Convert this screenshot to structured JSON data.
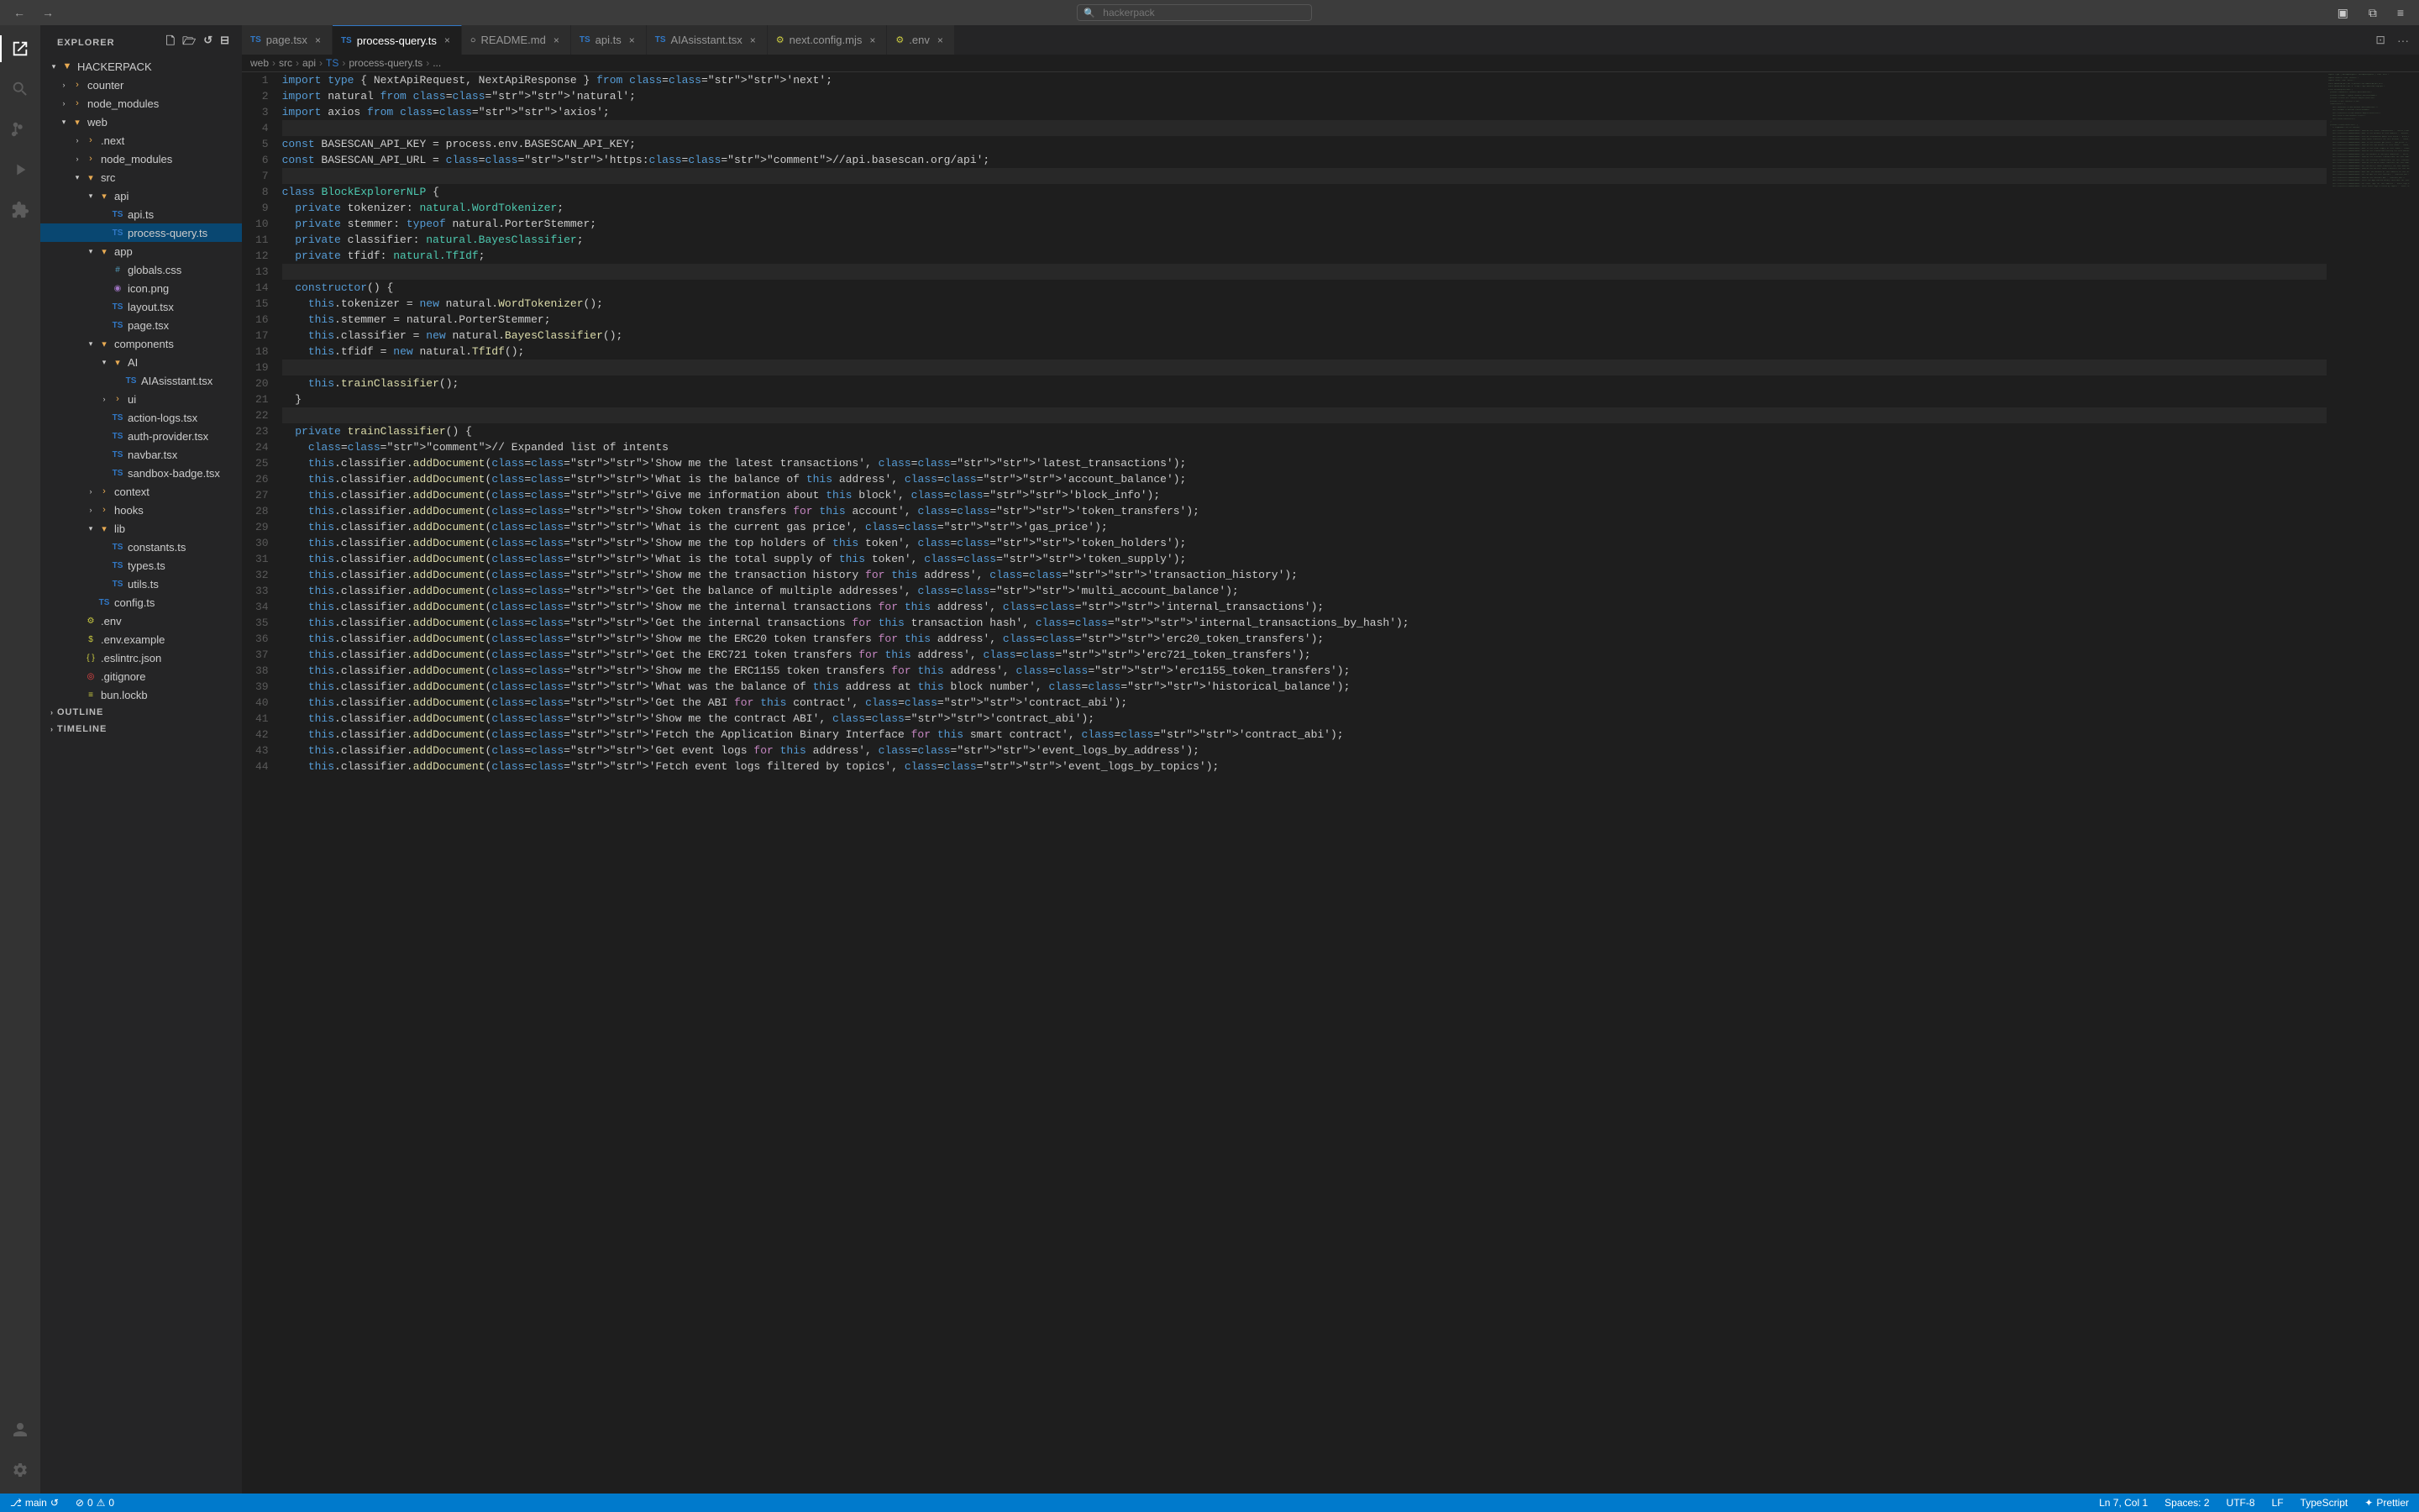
{
  "titleBar": {
    "searchPlaceholder": "hackerpack",
    "navBack": "←",
    "navForward": "→"
  },
  "activityBar": {
    "icons": [
      {
        "name": "explorer-icon",
        "symbol": "⎘",
        "active": true
      },
      {
        "name": "search-icon",
        "symbol": "🔍",
        "active": false
      },
      {
        "name": "source-control-icon",
        "symbol": "⎇",
        "active": false
      },
      {
        "name": "run-icon",
        "symbol": "▷",
        "active": false
      },
      {
        "name": "extensions-icon",
        "symbol": "⊞",
        "active": false
      }
    ],
    "bottomIcons": [
      {
        "name": "accounts-icon",
        "symbol": "👤"
      },
      {
        "name": "settings-icon",
        "symbol": "⚙"
      }
    ]
  },
  "sidebar": {
    "title": "EXPLORER",
    "rootFolder": "HACKERPACK",
    "tree": [
      {
        "id": "counter",
        "label": "counter",
        "type": "folder",
        "indent": 1,
        "open": false
      },
      {
        "id": "node_modules_root",
        "label": "node_modules",
        "type": "folder",
        "indent": 1,
        "open": false
      },
      {
        "id": "web",
        "label": "web",
        "type": "folder",
        "indent": 1,
        "open": true
      },
      {
        "id": "next",
        "label": ".next",
        "type": "folder",
        "indent": 2,
        "open": false
      },
      {
        "id": "node_modules_web",
        "label": "node_modules",
        "type": "folder",
        "indent": 2,
        "open": false
      },
      {
        "id": "src",
        "label": "src",
        "type": "folder",
        "indent": 2,
        "open": true
      },
      {
        "id": "api",
        "label": "api",
        "type": "folder",
        "indent": 3,
        "open": true
      },
      {
        "id": "api_ts",
        "label": "api.ts",
        "type": "ts",
        "indent": 4
      },
      {
        "id": "process_query",
        "label": "process-query.ts",
        "type": "ts",
        "indent": 4,
        "selected": true
      },
      {
        "id": "app",
        "label": "app",
        "type": "folder",
        "indent": 3,
        "open": true
      },
      {
        "id": "globals_css",
        "label": "globals.css",
        "type": "css",
        "indent": 4
      },
      {
        "id": "icon_png",
        "label": "icon.png",
        "type": "png",
        "indent": 4
      },
      {
        "id": "layout_tsx",
        "label": "layout.tsx",
        "type": "tsx",
        "indent": 4
      },
      {
        "id": "page_tsx",
        "label": "page.tsx",
        "type": "tsx",
        "indent": 4
      },
      {
        "id": "components",
        "label": "components",
        "type": "folder",
        "indent": 3,
        "open": true
      },
      {
        "id": "AI",
        "label": "AI",
        "type": "folder",
        "indent": 4,
        "open": true
      },
      {
        "id": "AIAsisstant_tsx",
        "label": "AIAsisstant.tsx",
        "type": "tsx",
        "indent": 5
      },
      {
        "id": "ui",
        "label": "ui",
        "type": "folder",
        "indent": 4,
        "open": false
      },
      {
        "id": "action_logs",
        "label": "action-logs.tsx",
        "type": "tsx",
        "indent": 4
      },
      {
        "id": "auth_provider",
        "label": "auth-provider.tsx",
        "type": "tsx",
        "indent": 4
      },
      {
        "id": "navbar_tsx",
        "label": "navbar.tsx",
        "type": "tsx",
        "indent": 4
      },
      {
        "id": "sandbox_badge",
        "label": "sandbox-badge.tsx",
        "type": "tsx",
        "indent": 4
      },
      {
        "id": "context",
        "label": "context",
        "type": "folder",
        "indent": 3,
        "open": false
      },
      {
        "id": "hooks",
        "label": "hooks",
        "type": "folder",
        "indent": 3,
        "open": false
      },
      {
        "id": "lib",
        "label": "lib",
        "type": "folder",
        "indent": 3,
        "open": true
      },
      {
        "id": "constants_ts",
        "label": "constants.ts",
        "type": "ts",
        "indent": 4
      },
      {
        "id": "types_ts",
        "label": "types.ts",
        "type": "ts",
        "indent": 4
      },
      {
        "id": "utils_ts",
        "label": "utils.ts",
        "type": "ts",
        "indent": 4
      },
      {
        "id": "config_ts",
        "label": "config.ts",
        "type": "ts",
        "indent": 3
      },
      {
        "id": "env",
        "label": ".env",
        "type": "env",
        "indent": 2
      },
      {
        "id": "env_example",
        "label": ".env.example",
        "type": "env",
        "indent": 2
      },
      {
        "id": "eslintrc",
        "label": ".eslintrc.json",
        "type": "json",
        "indent": 2
      },
      {
        "id": "gitignore",
        "label": ".gitignore",
        "type": "git",
        "indent": 2
      },
      {
        "id": "bun_lock",
        "label": "bun.lockb",
        "type": "lock",
        "indent": 2
      }
    ],
    "outlineLabel": "OUTLINE",
    "timelineLabel": "TIMELINE"
  },
  "tabs": [
    {
      "id": "page_tsx",
      "label": "page.tsx",
      "type": "tsx",
      "active": false,
      "dirty": false
    },
    {
      "id": "process_query",
      "label": "process-query.ts",
      "type": "ts",
      "active": true,
      "dirty": false
    },
    {
      "id": "readme",
      "label": "README.md",
      "type": "md",
      "active": false
    },
    {
      "id": "api_ts",
      "label": "api.ts",
      "type": "ts",
      "active": false
    },
    {
      "id": "AIAsisstant",
      "label": "AIAsisstant.tsx",
      "type": "tsx",
      "active": false
    },
    {
      "id": "next_config",
      "label": "next.config.mjs",
      "type": "mjs",
      "active": false
    },
    {
      "id": "env",
      "label": ".env",
      "type": "env",
      "active": false
    }
  ],
  "breadcrumb": {
    "parts": [
      "web",
      "src",
      "api",
      "TS",
      "process-query.ts",
      "..."
    ]
  },
  "code": {
    "lines": [
      {
        "n": 1,
        "content": "import type { NextApiRequest, NextApiResponse } from 'next';"
      },
      {
        "n": 2,
        "content": "import natural from 'natural';"
      },
      {
        "n": 3,
        "content": "import axios from 'axios';"
      },
      {
        "n": 4,
        "content": ""
      },
      {
        "n": 5,
        "content": "const BASESCAN_API_KEY = process.env.BASESCAN_API_KEY;"
      },
      {
        "n": 6,
        "content": "const BASESCAN_API_URL = 'https://api.basescan.org/api';"
      },
      {
        "n": 7,
        "content": ""
      },
      {
        "n": 8,
        "content": "class BlockExplorerNLP {"
      },
      {
        "n": 9,
        "content": "  private tokenizer: natural.WordTokenizer;"
      },
      {
        "n": 10,
        "content": "  private stemmer: typeof natural.PorterStemmer;"
      },
      {
        "n": 11,
        "content": "  private classifier: natural.BayesClassifier;"
      },
      {
        "n": 12,
        "content": "  private tfidf: natural.TfIdf;"
      },
      {
        "n": 13,
        "content": ""
      },
      {
        "n": 14,
        "content": "  constructor() {"
      },
      {
        "n": 15,
        "content": "    this.tokenizer = new natural.WordTokenizer();"
      },
      {
        "n": 16,
        "content": "    this.stemmer = natural.PorterStemmer;"
      },
      {
        "n": 17,
        "content": "    this.classifier = new natural.BayesClassifier();"
      },
      {
        "n": 18,
        "content": "    this.tfidf = new natural.TfIdf();"
      },
      {
        "n": 19,
        "content": ""
      },
      {
        "n": 20,
        "content": "    this.trainClassifier();"
      },
      {
        "n": 21,
        "content": "  }"
      },
      {
        "n": 22,
        "content": ""
      },
      {
        "n": 23,
        "content": "  private trainClassifier() {"
      },
      {
        "n": 24,
        "content": "    // Expanded list of intents"
      },
      {
        "n": 25,
        "content": "    this.classifier.addDocument('Show me the latest transactions', 'latest_transactions');"
      },
      {
        "n": 26,
        "content": "    this.classifier.addDocument('What is the balance of this address', 'account_balance');"
      },
      {
        "n": 27,
        "content": "    this.classifier.addDocument('Give me information about this block', 'block_info');"
      },
      {
        "n": 28,
        "content": "    this.classifier.addDocument('Show token transfers for this account', 'token_transfers');"
      },
      {
        "n": 29,
        "content": "    this.classifier.addDocument('What is the current gas price', 'gas_price');"
      },
      {
        "n": 30,
        "content": "    this.classifier.addDocument('Show me the top holders of this token', 'token_holders');"
      },
      {
        "n": 31,
        "content": "    this.classifier.addDocument('What is the total supply of this token', 'token_supply');"
      },
      {
        "n": 32,
        "content": "    this.classifier.addDocument('Show me the transaction history for this address', 'transaction_history');"
      },
      {
        "n": 33,
        "content": "    this.classifier.addDocument('Get the balance of multiple addresses', 'multi_account_balance');"
      },
      {
        "n": 34,
        "content": "    this.classifier.addDocument('Show me the internal transactions for this address', 'internal_transactions');"
      },
      {
        "n": 35,
        "content": "    this.classifier.addDocument('Get the internal transactions for this transaction hash', 'internal_transactions_by_hash');"
      },
      {
        "n": 36,
        "content": "    this.classifier.addDocument('Show me the ERC20 token transfers for this address', 'erc20_token_transfers');"
      },
      {
        "n": 37,
        "content": "    this.classifier.addDocument('Get the ERC721 token transfers for this address', 'erc721_token_transfers');"
      },
      {
        "n": 38,
        "content": "    this.classifier.addDocument('Show me the ERC1155 token transfers for this address', 'erc1155_token_transfers');"
      },
      {
        "n": 39,
        "content": "    this.classifier.addDocument('What was the balance of this address at this block number', 'historical_balance');"
      },
      {
        "n": 40,
        "content": "    this.classifier.addDocument('Get the ABI for this contract', 'contract_abi');"
      },
      {
        "n": 41,
        "content": "    this.classifier.addDocument('Show me the contract ABI', 'contract_abi');"
      },
      {
        "n": 42,
        "content": "    this.classifier.addDocument('Fetch the Application Binary Interface for this smart contract', 'contract_abi');"
      },
      {
        "n": 43,
        "content": "    this.classifier.addDocument('Get event logs for this address', 'event_logs_by_address');"
      },
      {
        "n": 44,
        "content": "    this.classifier.addDocument('Fetch event logs filtered by topics', 'event_logs_by_topics');"
      }
    ]
  },
  "statusBar": {
    "branch": "main",
    "errors": "0",
    "warnings": "0",
    "position": "Ln 7, Col 1",
    "spaces": "Spaces: 2",
    "encoding": "UTF-8",
    "eol": "LF",
    "language": "TypeScript",
    "prettier": "Prettier"
  }
}
